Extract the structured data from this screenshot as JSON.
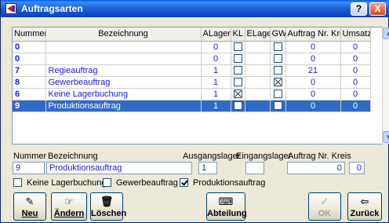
{
  "window": {
    "title": "Auftragsarten",
    "help_label": "?",
    "close_label": "X"
  },
  "table": {
    "columns": [
      "Nummer",
      "Bezeichnung",
      "ALager",
      "KL",
      "ELager",
      "GW",
      "Auftrag Nr. Kreis",
      "Umsatz-K"
    ],
    "rows": [
      {
        "nummer": "0",
        "bezeichnung": "",
        "alager": "0",
        "kl": false,
        "elager": "",
        "gw": false,
        "auftrag_nr_kreis": "0",
        "umsatz": "0",
        "selected": false
      },
      {
        "nummer": "0",
        "bezeichnung": "",
        "alager": "0",
        "kl": false,
        "elager": "",
        "gw": false,
        "auftrag_nr_kreis": "0",
        "umsatz": "0",
        "selected": false
      },
      {
        "nummer": "7",
        "bezeichnung": "Regieauftrag",
        "alager": "1",
        "kl": false,
        "elager": "",
        "gw": false,
        "auftrag_nr_kreis": "21",
        "umsatz": "0",
        "selected": false
      },
      {
        "nummer": "8",
        "bezeichnung": "Gewerbeauftrag",
        "alager": "1",
        "kl": false,
        "elager": "",
        "gw": true,
        "auftrag_nr_kreis": "0",
        "umsatz": "0",
        "selected": false
      },
      {
        "nummer": "6",
        "bezeichnung": "Keine Lagerbuchung",
        "alager": "1",
        "kl": true,
        "elager": "",
        "gw": false,
        "auftrag_nr_kreis": "0",
        "umsatz": "0",
        "selected": false
      },
      {
        "nummer": "9",
        "bezeichnung": "Produktionsauftrag",
        "alager": "1",
        "kl": false,
        "elager": "",
        "gw": false,
        "auftrag_nr_kreis": "0",
        "umsatz": "0",
        "selected": true
      }
    ],
    "scroll_up": "▲",
    "scroll_down": "▼"
  },
  "form": {
    "nummer_label": "Nummer",
    "nummer_value": "9",
    "bezeichnung_label": "Bezeichnung",
    "bezeichnung_value": "Produktionsauftrag",
    "ausgangslager_label": "Ausgangslager",
    "ausgangslager_value": "1",
    "eingangslager_label": "Eingangslager",
    "eingangslager_value": "",
    "auftrag_nr_kreis_label": "Auftrag Nr. Kreis",
    "auftrag_nr_kreis_value": "0",
    "umsatz_value": "0",
    "keine_lagerbuchung_label": "Keine Lagerbuchung",
    "keine_lagerbuchung_checked": false,
    "gewerbeauftrag_label": "Gewerbeauftrag",
    "gewerbeauftrag_checked": false,
    "produktionsauftrag_label": "Produktionsauftrag",
    "produktionsauftrag_checked": true
  },
  "buttons": {
    "neu": "Neu",
    "aendern": "Ändern",
    "loeschen": "Löschen",
    "abteilung": "Abteilung",
    "ok": "OK",
    "zurueck": "Zurück"
  },
  "icons": {
    "neu": "pencil-icon",
    "aendern": "hand-icon",
    "loeschen": "trash-icon",
    "abteilung": "keyboard-icon",
    "ok": "checkmark-icon",
    "zurueck": "door-exit-icon"
  },
  "colors": {
    "selection": "#316ac5",
    "value_text": "#1a1ad8",
    "titlebar": "#0a3fbd",
    "ok_check": "#4caf50"
  }
}
